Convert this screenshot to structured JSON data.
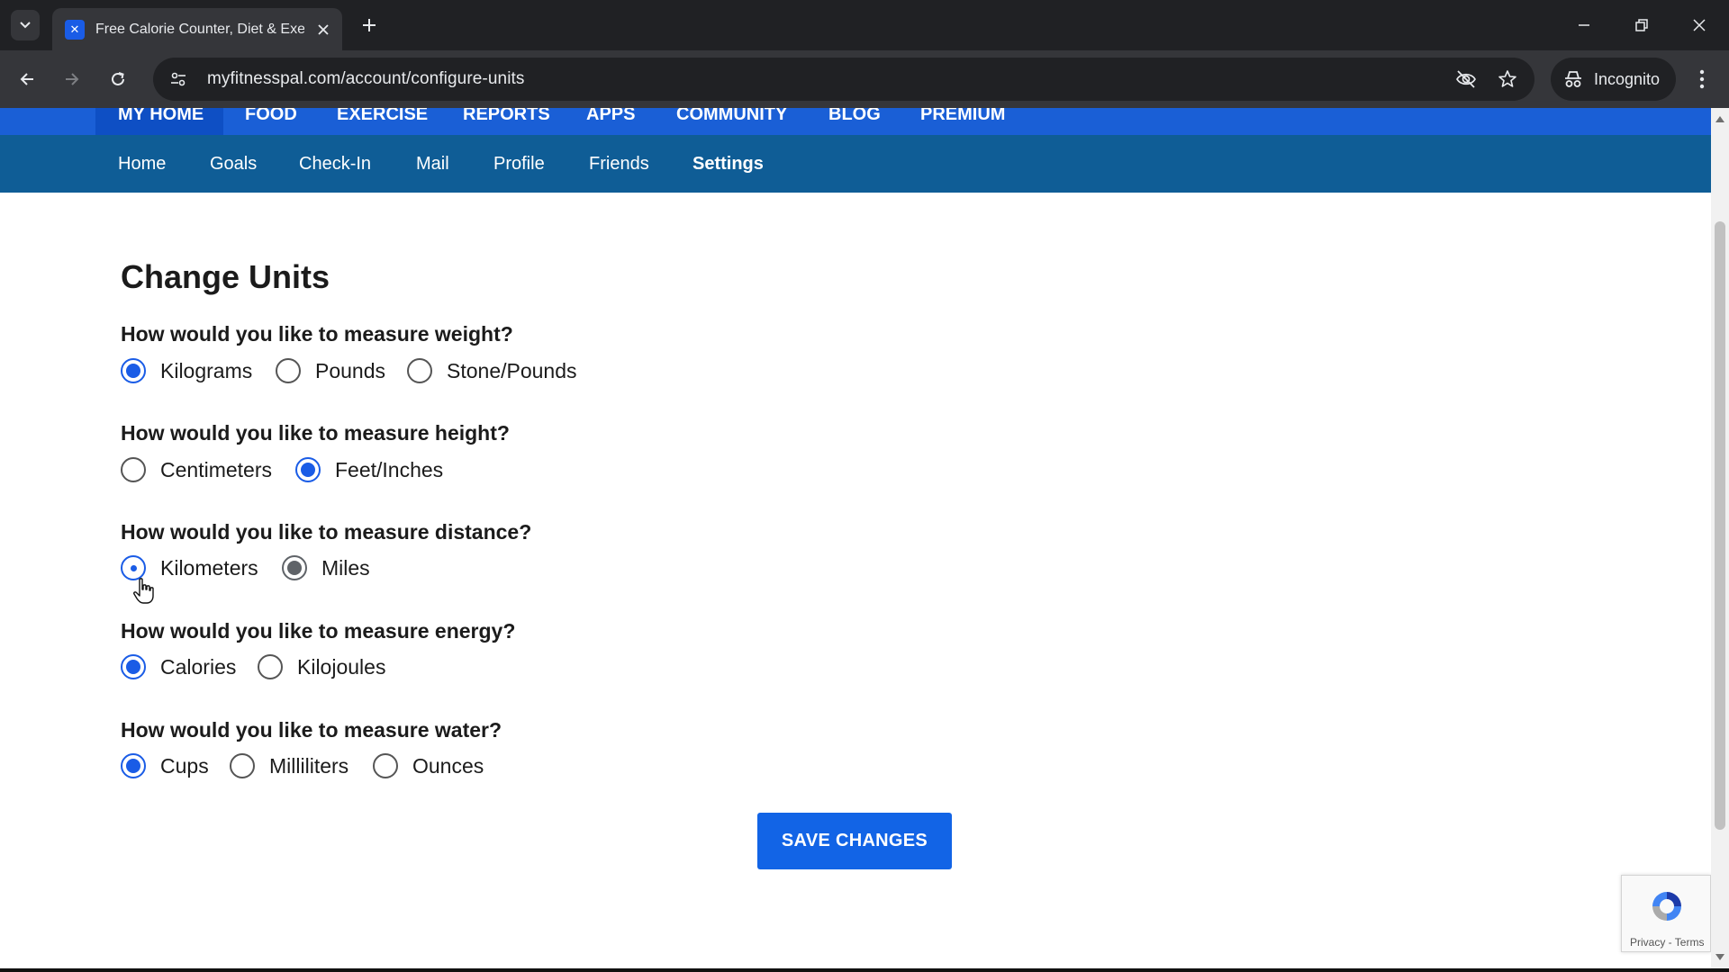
{
  "browser": {
    "tab_title": "Free Calorie Counter, Diet & Exercise",
    "url": "myfitnesspal.com/account/configure-units",
    "incognito_label": "Incognito"
  },
  "topnav": {
    "items": [
      "MY HOME",
      "FOOD",
      "EXERCISE",
      "REPORTS",
      "APPS",
      "COMMUNITY",
      "BLOG",
      "PREMIUM"
    ]
  },
  "subnav": {
    "items": [
      "Home",
      "Goals",
      "Check-In",
      "Mail",
      "Profile",
      "Friends",
      "Settings"
    ],
    "active": "Settings"
  },
  "page": {
    "title": "Change Units",
    "sections": [
      {
        "question": "How would you like to measure weight?",
        "options": [
          "Kilograms",
          "Pounds",
          "Stone/Pounds"
        ],
        "selected": "Kilograms"
      },
      {
        "question": "How would you like to measure height?",
        "options": [
          "Centimeters",
          "Feet/Inches"
        ],
        "selected": "Feet/Inches"
      },
      {
        "question": "How would you like to measure distance?",
        "options": [
          "Kilometers",
          "Miles"
        ],
        "selected": "Miles"
      },
      {
        "question": "How would you like to measure energy?",
        "options": [
          "Calories",
          "Kilojoules"
        ],
        "selected": "Calories"
      },
      {
        "question": "How would you like to measure water?",
        "options": [
          "Cups",
          "Milliliters",
          "Ounces"
        ],
        "selected": "Cups"
      }
    ],
    "save_label": "SAVE CHANGES"
  },
  "recaptcha": {
    "text": "Privacy - Terms"
  },
  "colors": {
    "accent": "#1a5ce6",
    "topnav": "#1a5fd6",
    "subnav": "#0f5d96",
    "button": "#1264e6"
  }
}
